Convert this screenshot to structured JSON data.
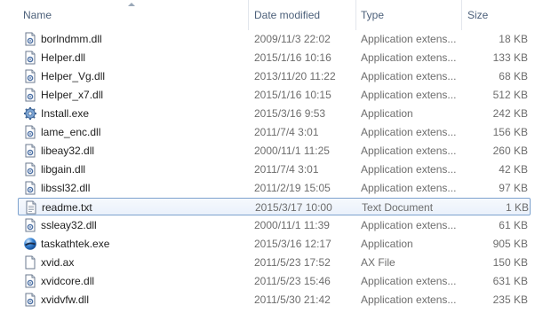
{
  "columns": {
    "name": "Name",
    "date": "Date modified",
    "type": "Type",
    "size": "Size"
  },
  "files": [
    {
      "name": "borlndmm.dll",
      "date": "2009/11/3 22:02",
      "type": "Application extens...",
      "size": "18 KB",
      "icon": "dll-icon"
    },
    {
      "name": "Helper.dll",
      "date": "2015/1/16 10:16",
      "type": "Application extens...",
      "size": "133 KB",
      "icon": "dll-icon"
    },
    {
      "name": "Helper_Vg.dll",
      "date": "2013/11/20 11:22",
      "type": "Application extens...",
      "size": "68 KB",
      "icon": "dll-icon"
    },
    {
      "name": "Helper_x7.dll",
      "date": "2015/1/16 10:15",
      "type": "Application extens...",
      "size": "512 KB",
      "icon": "dll-icon"
    },
    {
      "name": "Install.exe",
      "date": "2015/3/16 9:53",
      "type": "Application",
      "size": "242 KB",
      "icon": "gear-exe-icon"
    },
    {
      "name": "lame_enc.dll",
      "date": "2011/7/4 3:01",
      "type": "Application extens...",
      "size": "156 KB",
      "icon": "dll-icon"
    },
    {
      "name": "libeay32.dll",
      "date": "2000/11/1 11:25",
      "type": "Application extens...",
      "size": "260 KB",
      "icon": "dll-icon"
    },
    {
      "name": "libgain.dll",
      "date": "2011/7/4 3:01",
      "type": "Application extens...",
      "size": "42 KB",
      "icon": "dll-icon"
    },
    {
      "name": "libssl32.dll",
      "date": "2011/2/19 15:05",
      "type": "Application extens...",
      "size": "97 KB",
      "icon": "dll-icon"
    },
    {
      "name": "readme.txt",
      "date": "2015/3/17 10:00",
      "type": "Text Document",
      "size": "1 KB",
      "icon": "text-file-icon",
      "selected": true
    },
    {
      "name": "ssleay32.dll",
      "date": "2000/11/1 11:39",
      "type": "Application extens...",
      "size": "61 KB",
      "icon": "dll-icon"
    },
    {
      "name": "taskathtek.exe",
      "date": "2015/3/16 12:17",
      "type": "Application",
      "size": "905 KB",
      "icon": "blue-orb-exe-icon"
    },
    {
      "name": "xvid.ax",
      "date": "2011/5/23 17:52",
      "type": "AX File",
      "size": "150 KB",
      "icon": "blank-file-icon"
    },
    {
      "name": "xvidcore.dll",
      "date": "2011/5/23 15:46",
      "type": "Application extens...",
      "size": "631 KB",
      "icon": "dll-icon"
    },
    {
      "name": "xvidvfw.dll",
      "date": "2011/5/30 21:42",
      "type": "Application extens...",
      "size": "235 KB",
      "icon": "dll-icon"
    }
  ],
  "colors": {
    "header_text": "#4c607a",
    "selection_border": "#7da2ce",
    "detail_text": "#6d6d6d"
  }
}
